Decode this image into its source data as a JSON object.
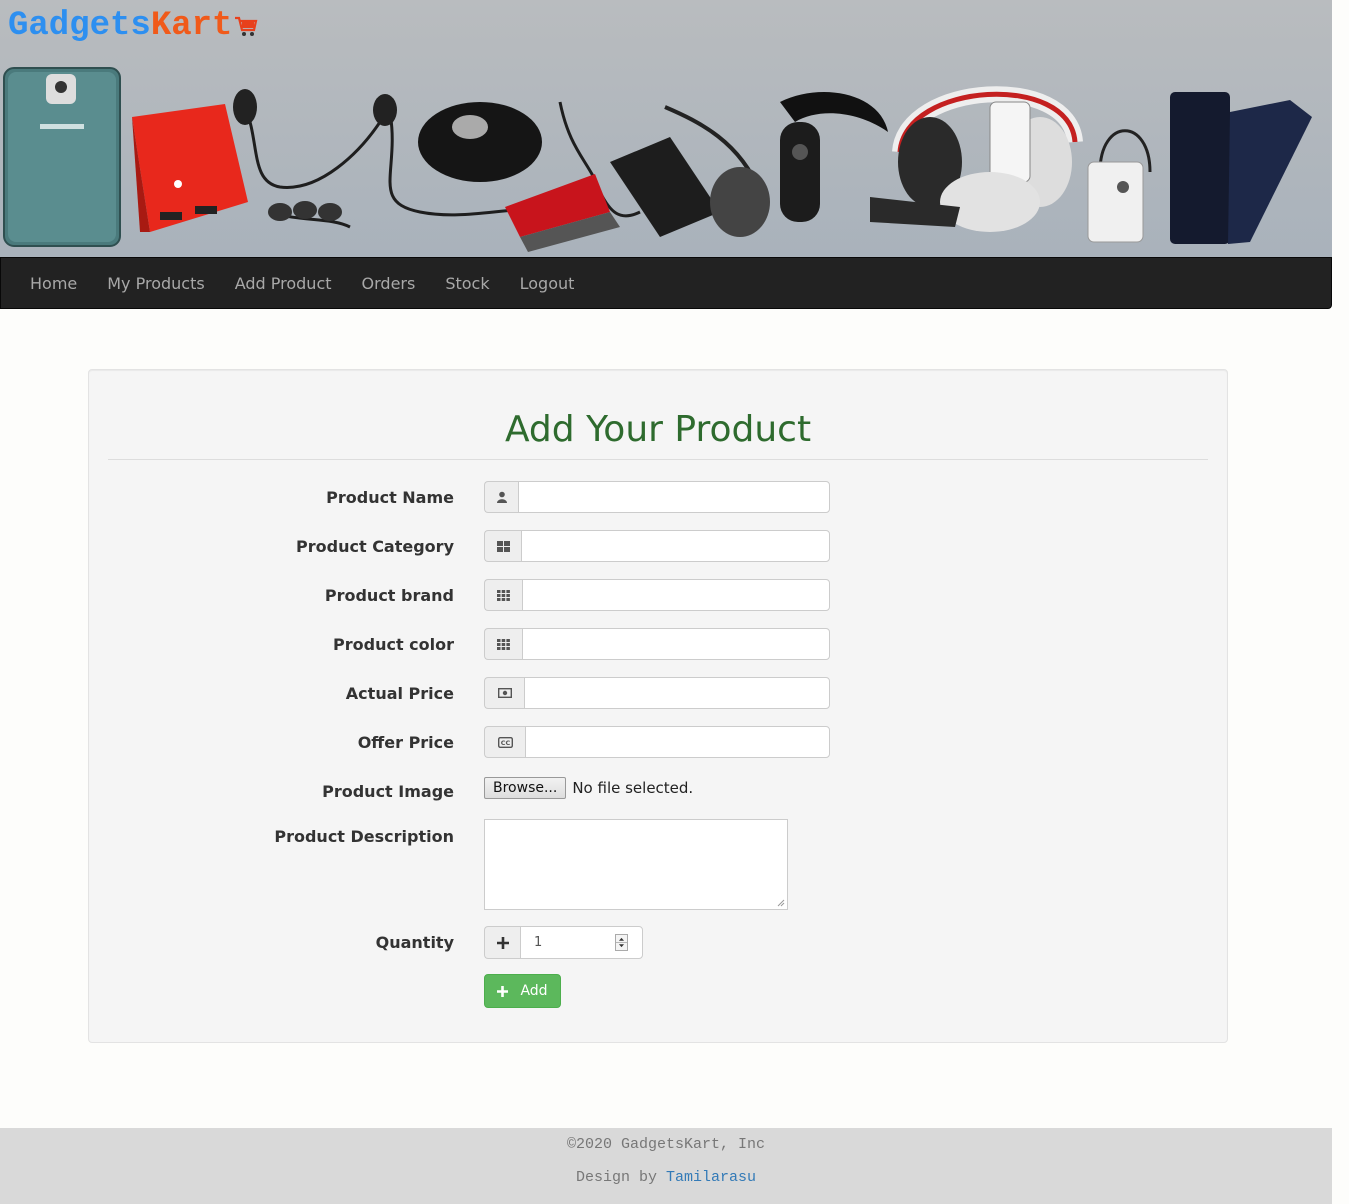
{
  "header": {
    "logo_part1": "Gadgets",
    "logo_part2": "Kart"
  },
  "nav": {
    "items": [
      "Home",
      "My Products",
      "Add Product",
      "Orders",
      "Stock",
      "Logout"
    ]
  },
  "form": {
    "title": "Add Your Product",
    "fields": {
      "product_name": {
        "label": "Product Name",
        "value": "",
        "icon": "user-icon"
      },
      "product_category": {
        "label": "Product Category",
        "value": "",
        "icon": "th-large-icon"
      },
      "product_brand": {
        "label": "Product brand",
        "value": "",
        "icon": "th-icon"
      },
      "product_color": {
        "label": "Product color",
        "value": "",
        "icon": "th-icon"
      },
      "actual_price": {
        "label": "Actual Price",
        "value": "",
        "icon": "money-icon"
      },
      "offer_price": {
        "label": "Offer Price",
        "value": "",
        "icon": "cc-icon"
      },
      "product_image": {
        "label": "Product Image",
        "button": "Browse...",
        "status": "No file selected."
      },
      "product_description": {
        "label": "Product Description",
        "value": ""
      },
      "quantity": {
        "label": "Quantity",
        "value": "1",
        "icon": "plus-icon"
      }
    },
    "submit_label": "Add"
  },
  "footer": {
    "copyright": "©2020 GadgetsKart, Inc",
    "credit_prefix": "Design by ",
    "author": "Tamilarasu"
  },
  "colors": {
    "logo_blue": "#2d8ff0",
    "logo_orange": "#f05a1a",
    "title_green": "#2e6b2e",
    "button_green": "#5cb85c",
    "navbar": "#222222",
    "link_blue": "#337ab7"
  }
}
